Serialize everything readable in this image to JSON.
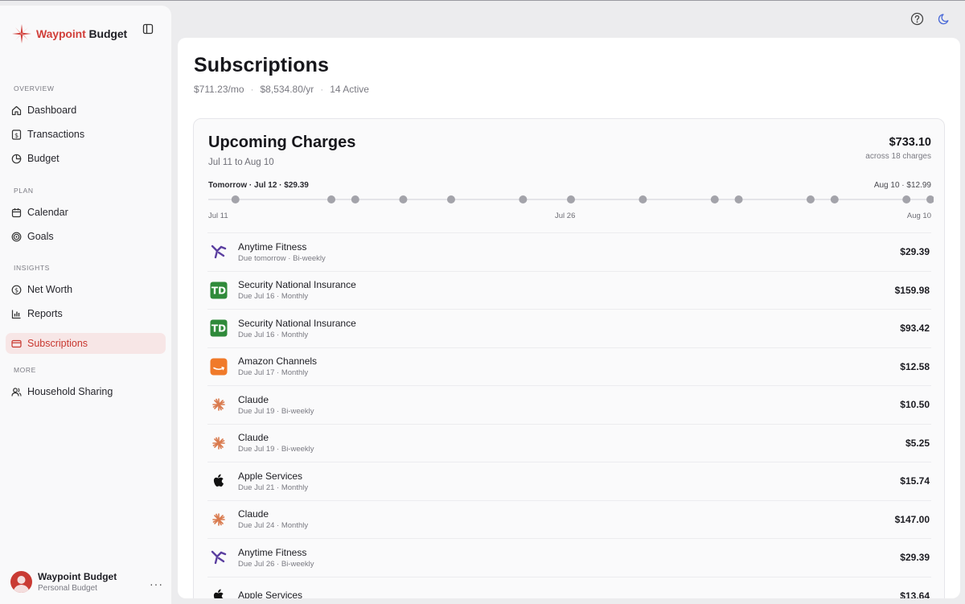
{
  "brand": {
    "name_first": "Waypoint",
    "name_second": " Budget"
  },
  "sidebar": {
    "sections": [
      {
        "label": "OVERVIEW",
        "items": [
          {
            "label": "Dashboard",
            "icon": "home-icon"
          },
          {
            "label": "Transactions",
            "icon": "dollar-doc-icon"
          },
          {
            "label": "Budget",
            "icon": "pie-icon"
          }
        ]
      },
      {
        "label": "PLAN",
        "items": [
          {
            "label": "Calendar",
            "icon": "calendar-icon"
          },
          {
            "label": "Goals",
            "icon": "target-icon"
          }
        ]
      },
      {
        "label": "INSIGHTS",
        "items": [
          {
            "label": "Net Worth",
            "icon": "dollar-circle-icon"
          },
          {
            "label": "Reports",
            "icon": "bar-chart-icon"
          },
          {
            "label": "Subscriptions",
            "icon": "card-icon",
            "active": true
          }
        ]
      },
      {
        "label": "MORE",
        "items": [
          {
            "label": "Household Sharing",
            "icon": "users-icon"
          }
        ]
      }
    ]
  },
  "user": {
    "name": "Waypoint Budget",
    "subtitle": "Personal Budget",
    "more": "···"
  },
  "page": {
    "title": "Subscriptions",
    "monthly": "$711.23/mo",
    "yearly": "$8,534.80/yr",
    "active": "14 Active",
    "separator": "·"
  },
  "upcoming": {
    "title": "Upcoming Charges",
    "range": "Jul 11 to Aug 10",
    "total": "$733.10",
    "count": "across 18 charges",
    "first_label": "Tomorrow · Jul 12 · $29.39",
    "last_label": "Aug 10 · $12.99",
    "ticks": [
      "Jul 11",
      "Jul 26",
      "Aug 10"
    ],
    "timeline_points": [
      0.0333,
      0.1667,
      0.2,
      0.2667,
      0.3333,
      0.4333,
      0.5,
      0.6,
      0.7,
      0.7333,
      0.8333,
      0.8667,
      0.9667,
      1.0
    ],
    "charges": [
      {
        "name": "Anytime Fitness",
        "due": "Due tomorrow · Bi-weekly",
        "amount": "$29.39",
        "icon": "runner-icon"
      },
      {
        "name": "Security National Insurance",
        "due": "Due Jul 16 · Monthly",
        "amount": "$159.98",
        "icon": "td-icon"
      },
      {
        "name": "Security National Insurance",
        "due": "Due Jul 16 · Monthly",
        "amount": "$93.42",
        "icon": "td-icon"
      },
      {
        "name": "Amazon Channels",
        "due": "Due Jul 17 · Monthly",
        "amount": "$12.58",
        "icon": "amazon-icon"
      },
      {
        "name": "Claude",
        "due": "Due Jul 19 · Bi-weekly",
        "amount": "$10.50",
        "icon": "claude-icon"
      },
      {
        "name": "Claude",
        "due": "Due Jul 19 · Bi-weekly",
        "amount": "$5.25",
        "icon": "claude-icon"
      },
      {
        "name": "Apple Services",
        "due": "Due Jul 21 · Monthly",
        "amount": "$15.74",
        "icon": "apple-icon"
      },
      {
        "name": "Claude",
        "due": "Due Jul 24 · Monthly",
        "amount": "$147.00",
        "icon": "claude-icon"
      },
      {
        "name": "Anytime Fitness",
        "due": "Due Jul 26 · Bi-weekly",
        "amount": "$29.39",
        "icon": "runner-icon"
      },
      {
        "name": "Apple Services",
        "due": "",
        "amount": "$13.64",
        "icon": "apple-icon"
      }
    ]
  },
  "colors": {
    "accent": "#c8372f",
    "td_green": "#2f8a3a",
    "amazon_orange": "#f07a2a",
    "claude_orange": "#d97a4e",
    "runner_purple": "#5b3fa0"
  }
}
